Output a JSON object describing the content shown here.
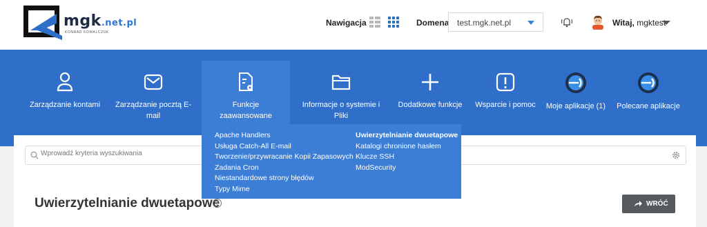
{
  "header": {
    "logo_text": "mgk",
    "logo_tld": ".net.pl",
    "logo_sub": "KONRAD KOWALCZUK",
    "nav_label": "Nawigacja",
    "domain_label": "Domena",
    "domain_value": "test.mgk.net.pl",
    "greeting_prefix": "Witaj,",
    "username": "mgktest"
  },
  "nav": {
    "items": [
      {
        "label": "Zarządzanie kontami",
        "icon": "user-icon"
      },
      {
        "label": "Zarządzanie pocztą E-mail",
        "icon": "envelope-icon"
      },
      {
        "label": "Funkcje zaawansowane",
        "icon": "document-gear-icon",
        "active": true
      },
      {
        "label": "Informacje o systemie i Pliki",
        "icon": "folder-icon"
      },
      {
        "label": "Dodatkowe funkcje",
        "icon": "plus-icon"
      },
      {
        "label": "Wsparcie i pomoc",
        "icon": "exclamation-icon"
      },
      {
        "label": "Moje aplikacje (1)",
        "icon": "app-circle-icon"
      },
      {
        "label": "Polecane aplikacje",
        "icon": "app-circle-icon"
      }
    ]
  },
  "dropdown": {
    "col1": [
      "Apache Handlers",
      "Usługa Catch-All E-mail",
      "Tworzenie/przywracanie Kopii Zapasowych",
      "Zadania Cron",
      "Niestandardowe strony błędów",
      "Typy Mime"
    ],
    "col2": [
      "Uwierzytelnianie dwuetapowe",
      "Katalogi chronione hasłem",
      "Klucze SSH",
      "ModSecurity"
    ]
  },
  "search": {
    "placeholder": "Wprowadź kryteria wyszukiwania"
  },
  "page": {
    "title": "Uwierzytelnianie dwuetapowe",
    "help": "?",
    "back_label": "WRÓĆ"
  },
  "colors": {
    "brand_blue": "#2f6fc9",
    "active_blue": "#3c7ed6",
    "back_button": "#555a5f"
  }
}
